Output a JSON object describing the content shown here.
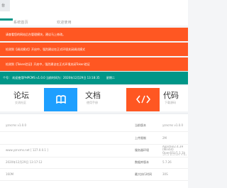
{
  "header": {
    "tab_mark": "台",
    "tabs": [
      "系统首页",
      "欢迎使用"
    ]
  },
  "alerts": [
    "请查看您的网站后台管理模块，建议马上修改。",
    "检测到【调试模式】开启中，强烈建议在正式环境关闭调试模式",
    "检测到【Token验证】开启中，强烈建议在正式环境关闭Token验证"
  ],
  "notice": {
    "prefix": "个号：",
    "text": "欢迎使用PHPCMS v1.0.0 当前时间为：2020年12月29日 13:18:35",
    "suffix": "星期二"
  },
  "shortcuts": [
    {
      "title": "论坛",
      "subtitle": "交流社区",
      "icon": "chat-bubbles-icon"
    },
    {
      "title": "",
      "subtitle": "",
      "icon": "book-icon",
      "color": "#1e9fff"
    },
    {
      "title": "文档",
      "subtitle": "使用手册",
      "icon": "document-icon"
    },
    {
      "title": "",
      "subtitle": "",
      "icon": "code-icon",
      "color": "#ff5722"
    },
    {
      "title": "代码",
      "subtitle": "下载源码",
      "icon": "download-icon"
    }
  ],
  "info": {
    "rows": [
      {
        "left_value": "yzncms v1.0.0",
        "right_key": "当前版本",
        "right_value": "yzncms v1.0.0"
      },
      {
        "left_value": "",
        "right_key": "上传限制",
        "right_value": "2M"
      },
      {
        "left_value": "www.yzncms.net [ 127.0.0.1 ]",
        "right_key": "服务器环境",
        "right_value": "Apache/2.4.39 (Win64) OpenSSL/1.1.1b mod_fcgid/2.3.9a mod_log_rotate/1.02"
      },
      {
        "left_value": "2020年12月29日 13:17:12",
        "right_key": "数据库版本",
        "right_value": "5.7.26"
      },
      {
        "left_value": "160M",
        "right_key": "最大执行时间",
        "right_value": "30S"
      }
    ],
    "row3_right_value_short": "Apache/2.4.39 (Win64) Ope",
    "row3_right_value_line2": "mod_log_rotate/1.02",
    "row4_right_value_display": "Windows NT",
    "row5_right_value_display": "256M"
  },
  "colors": {
    "alert": "#ff5722",
    "notice": "#009688",
    "tile_blue": "#1e9fff",
    "tile_orange": "#ff5722"
  }
}
